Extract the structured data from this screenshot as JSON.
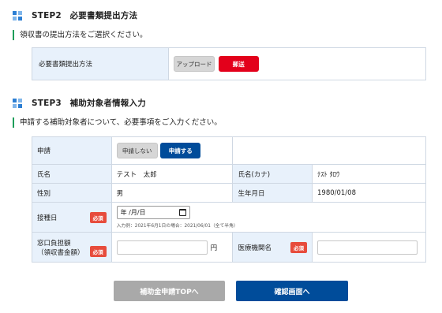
{
  "step2": {
    "title": "STEP2　必要書類提出方法",
    "lead": "領収書の提出方法をご選択ください。",
    "row_label": "必要書類提出方法",
    "upload_label": "アップロード",
    "mail_label": "郵送"
  },
  "step3": {
    "title": "STEP3　補助対象者情報入力",
    "lead": "申請する補助対象者について、必要事項をご入力ください。",
    "apply_label": "申請",
    "not_apply_button": "申請しない",
    "apply_button": "申請する",
    "name_label": "氏名",
    "name_value": "テスト　太郎",
    "kana_label": "氏名(カナ)",
    "kana_value": "ﾃｽﾄ ﾀﾛｳ",
    "gender_label": "性別",
    "gender_value": "男",
    "birth_label": "生年月日",
    "birth_value": "1980/01/08",
    "vacc_label": "接種日",
    "required_badge": "必須",
    "date_placeholder": "年 /月/日",
    "date_hint": "入力例：2021年6月1日の場合：2021/06/01（全て半角）",
    "copay_label_line1": "窓口負担額",
    "copay_label_line2": "（領収書金額）",
    "yen_unit": "円",
    "clinic_label": "医療機関名"
  },
  "buttons": {
    "top_label": "補助金申請TOPへ",
    "confirm_label": "確認画面へ"
  },
  "colors": {
    "accent_blue": "#004c9a",
    "red": "#e3001b",
    "green_bar": "#1e9e5a",
    "header_bg": "#e8f1fb"
  }
}
